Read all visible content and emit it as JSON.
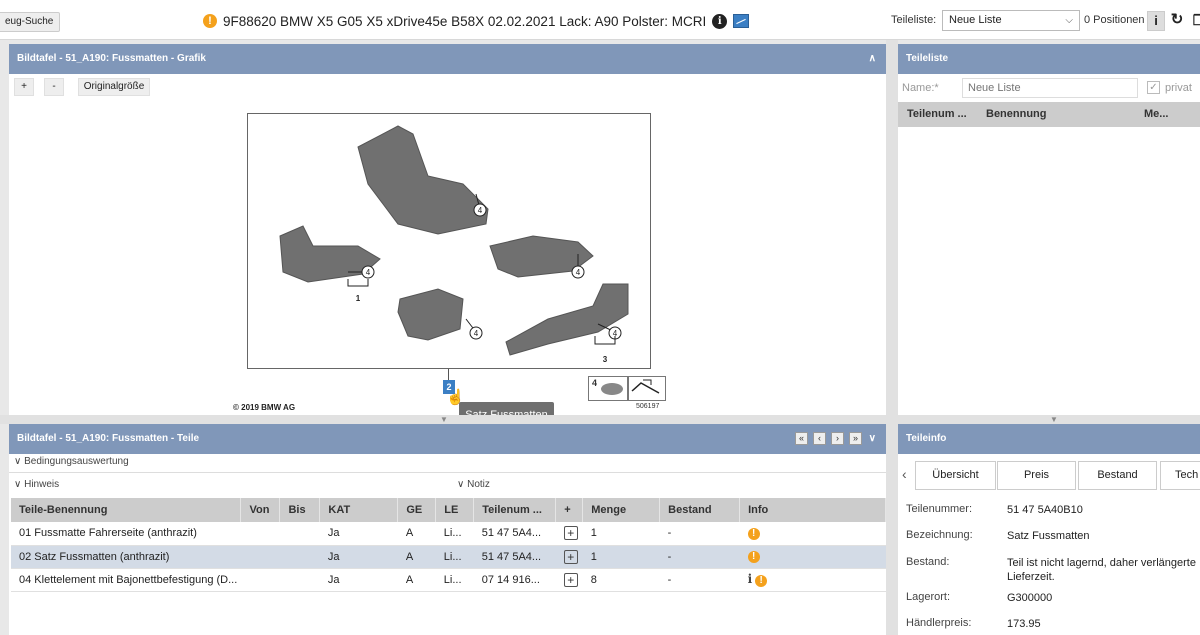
{
  "topbar": {
    "search_button": "eug-Suche",
    "vehicle": "9F88620 BMW X5 G05 X5 xDrive45e B58X 02.02.2021 Lack: A90 Polster: MCRI",
    "teileliste_label": "Teileliste:",
    "teileliste_value": "Neue Liste",
    "positions": "0 Positionen",
    "icons": [
      "warning-icon",
      "info-icon",
      "image-icon",
      "refresh-icon",
      "copy-icon"
    ]
  },
  "graphic_panel": {
    "title": "Bildtafel - 51_A190: Fussmatten - Grafik",
    "zoom_in": "+",
    "zoom_out": "-",
    "original_size": "Originalgröße",
    "copyright": "© 2019 BMW AG",
    "callouts": [
      "4",
      "4",
      "4",
      "4",
      "4",
      "1",
      "3"
    ],
    "highlight_label": "2",
    "thumb_number": "4",
    "thumb_id": "506197",
    "tooltip": "Satz Fussmatten"
  },
  "parts_panel": {
    "title": "Bildtafel - 51_A190: Fussmatten - Teile",
    "nav": [
      "«",
      "‹",
      "›",
      "»"
    ],
    "bedingungsauswertung": "Bedingungsauswertung",
    "hinweis": "Hinweis",
    "notiz": "Notiz",
    "columns": [
      "Teile-Benennung",
      "Von",
      "Bis",
      "KAT",
      "GE",
      "LE",
      "Teilenum ...",
      "+",
      "Menge",
      "Bestand",
      "Info"
    ],
    "rows": [
      {
        "name": "01 Fussmatte Fahrerseite (anthrazit)",
        "von": "",
        "bis": "",
        "kat": "Ja",
        "ge": "A",
        "le": "Li...",
        "num": "51 47 5A4...",
        "menge": "1",
        "bestand": "-",
        "selected": false,
        "info": [
          "warning"
        ]
      },
      {
        "name": "02 Satz Fussmatten (anthrazit)",
        "von": "",
        "bis": "",
        "kat": "Ja",
        "ge": "A",
        "le": "Li...",
        "num": "51 47 5A4...",
        "menge": "1",
        "bestand": "-",
        "selected": true,
        "info": [
          "warning"
        ]
      },
      {
        "name": "04 Klettelement mit Bajonettbefestigung (D...",
        "von": "",
        "bis": "",
        "kat": "Ja",
        "ge": "A",
        "le": "Li...",
        "num": "07 14 916...",
        "menge": "8",
        "bestand": "-",
        "selected": false,
        "info": [
          "info",
          "warning"
        ]
      }
    ]
  },
  "teileliste_panel": {
    "title": "Teileliste",
    "name_label": "Name:*",
    "name_placeholder": "Neue Liste",
    "privat_label": "privat",
    "columns": [
      "Teilenum ...",
      "Benennung",
      "Me..."
    ]
  },
  "teileinfo_panel": {
    "title": "Teileinfo",
    "tabs": [
      "Übersicht",
      "Preis",
      "Bestand",
      "Tech"
    ],
    "fields": [
      {
        "key": "Teilenummer:",
        "value": "51 47 5A40B10"
      },
      {
        "key": "Bezeichnung:",
        "value": "Satz Fussmatten"
      },
      {
        "key": "Bestand:",
        "value": "Teil ist nicht lagernd, daher verlängerte Lieferzeit."
      },
      {
        "key": "Lagerort:",
        "value": "G300000"
      },
      {
        "key": "Händlerpreis:",
        "value": "173.95"
      }
    ]
  },
  "colors": {
    "header": "#8097b9",
    "warning": "#f4a11c",
    "selected_row": "#d3dbe6"
  }
}
